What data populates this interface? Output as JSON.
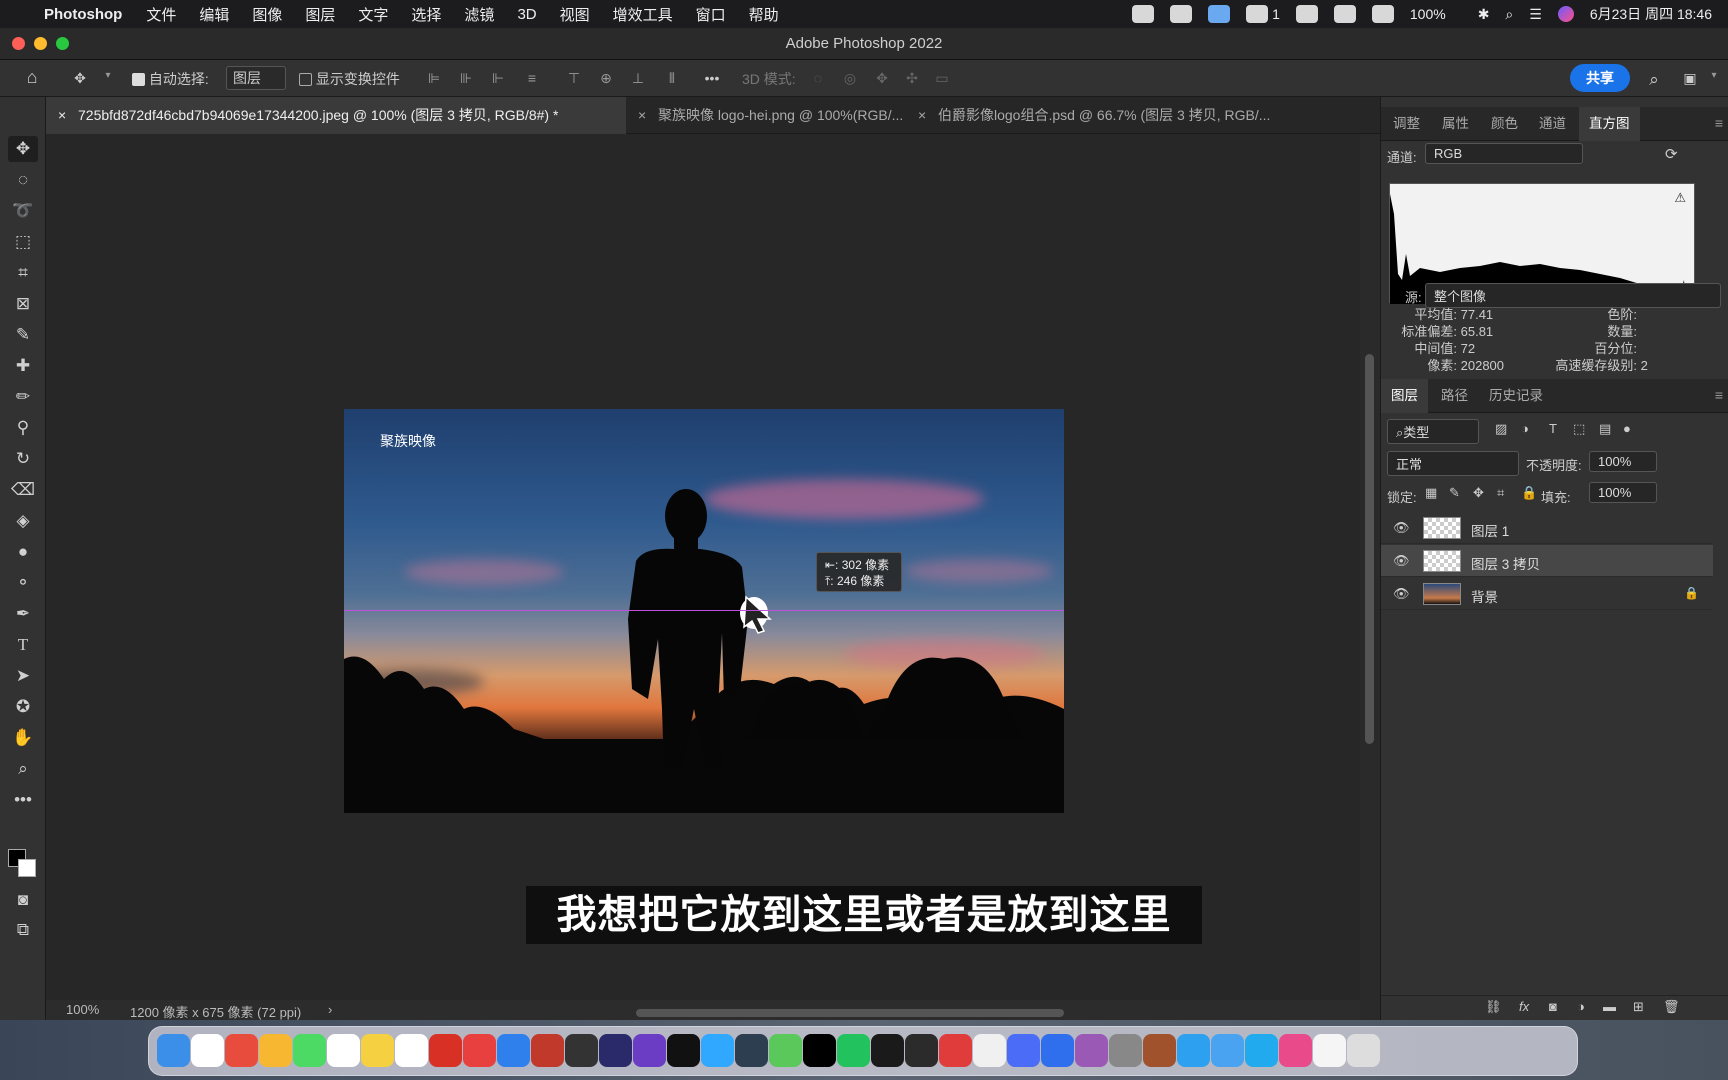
{
  "menubar": {
    "app_name": "Photoshop",
    "menus": [
      "文件",
      "编辑",
      "图像",
      "图层",
      "文字",
      "选择",
      "滤镜",
      "3D",
      "视图",
      "增效工具",
      "窗口",
      "帮助"
    ],
    "status_items": {
      "wechat_count": "1",
      "battery": "100%",
      "datetime": "6月23日 周四  18:46"
    }
  },
  "window": {
    "title": "Adobe Photoshop 2022"
  },
  "options_bar": {
    "auto_select_label": "自动选择:",
    "auto_select_value": "图层",
    "show_transform_label": "显示变换控件",
    "mode_3d_label": "3D 模式:",
    "share_label": "共享"
  },
  "doc_tabs": [
    {
      "label": "725bfd872df46cbd7b94069e17344200.jpeg @ 100% (图层 3 拷贝, RGB/8#) *"
    },
    {
      "label": "聚族映像 logo-hei.png @ 100%(RGB/..."
    },
    {
      "label": "伯爵影像logo组合.psd @ 66.7% (图层 3 拷贝, RGB/..."
    }
  ],
  "canvas": {
    "watermark_text": "聚族映像",
    "tooltip_line1": "⇤: 302 像素",
    "tooltip_line2": "⤒: 246 像素",
    "subtitle": "我想把它放到这里或者是放到这里"
  },
  "status_bar": {
    "zoom": "100%",
    "doc_info": "1200 像素 x 675 像素 (72 ppi)"
  },
  "top_panel": {
    "tabs": [
      "调整",
      "属性",
      "颜色",
      "通道",
      "直方图"
    ],
    "active_tab": "直方图",
    "channel_label": "通道:",
    "channel_value": "RGB",
    "source_label": "源:",
    "source_value": "整个图像",
    "stats_left": [
      {
        "label": "平均值:",
        "value": "77.41"
      },
      {
        "label": "标准偏差:",
        "value": "65.81"
      },
      {
        "label": "中间值:",
        "value": "72"
      },
      {
        "label": "像素:",
        "value": "202800"
      }
    ],
    "stats_right": [
      {
        "label": "色阶:",
        "value": ""
      },
      {
        "label": "数量:",
        "value": ""
      },
      {
        "label": "百分位:",
        "value": ""
      },
      {
        "label": "高速缓存级别:",
        "value": "2"
      }
    ]
  },
  "layers_panel": {
    "tabs": [
      "图层",
      "路径",
      "历史记录"
    ],
    "filter_label": "类型",
    "blend_mode": "正常",
    "opacity_label": "不透明度:",
    "opacity_value": "100%",
    "lock_label": "锁定:",
    "fill_label": "填充:",
    "fill_value": "100%",
    "layers": [
      {
        "name": "图层 1",
        "selected": false,
        "locked": false
      },
      {
        "name": "图层 3 拷贝",
        "selected": true,
        "locked": false
      },
      {
        "name": "背景",
        "selected": false,
        "locked": true
      }
    ]
  },
  "dock": {
    "colors": [
      "#3b8fe8",
      "#ffffff",
      "#e84c3d",
      "#f7b731",
      "#4cd964",
      "#ffffff",
      "#f5d142",
      "#ffffff",
      "#d93025",
      "#e83f3f",
      "#2f80ed",
      "#c0392b",
      "#333333",
      "#2a2a6a",
      "#6a3dc4",
      "#111111",
      "#31a8ff",
      "#2c3e50",
      "#5ac85a",
      "#000000",
      "#22c35e",
      "#1a1a1a",
      "#2b2b2b",
      "#e03c3c",
      "#f0f0f0",
      "#4a6cf7",
      "#2f6fed",
      "#9b59b6",
      "#888888",
      "#a0522d",
      "#2ea0f0",
      "#4aa3f0",
      "#22aaee",
      "#e84a8a",
      "#f5f5f5",
      "#dddddd"
    ]
  }
}
